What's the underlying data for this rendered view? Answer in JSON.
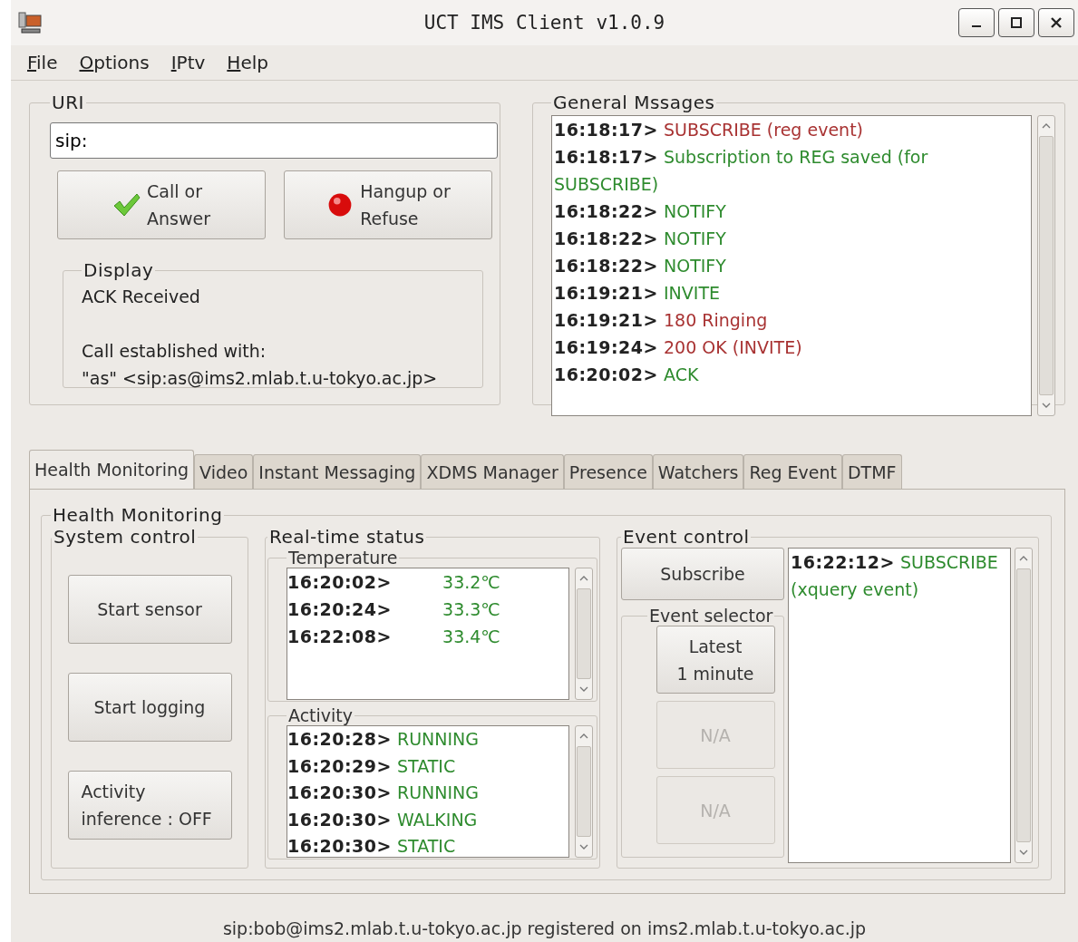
{
  "window": {
    "title": "UCT IMS Client v1.0.9"
  },
  "menu": [
    "File",
    "Options",
    "IPtv",
    "Help"
  ],
  "uri": {
    "label": "URI",
    "value": "sip:"
  },
  "call_buttons": [
    {
      "kind": "call",
      "label": "Call or\nAnswer"
    },
    {
      "kind": "hangup",
      "label": "Hangup or\nRefuse"
    }
  ],
  "display": {
    "label": "Display",
    "paragraphs": [
      [
        "ACK Received"
      ],
      [
        "Call established with:",
        "\"as\" <sip:as@ims2.mlab.t.u-tokyo.ac.jp>"
      ]
    ]
  },
  "general_messages": {
    "label": "General Mssages",
    "items": [
      {
        "time": "16:18:17>",
        "text": "SUBSCRIBE (reg event)",
        "color": "#a83232"
      },
      {
        "time": "16:18:17>",
        "text": "Subscription to REG saved (for SUBSCRIBE)",
        "color": "#2e8b2e"
      },
      {
        "time": "16:18:22>",
        "text": "NOTIFY",
        "color": "#2e8b2e"
      },
      {
        "time": "16:18:22>",
        "text": "NOTIFY",
        "color": "#2e8b2e"
      },
      {
        "time": "16:18:22>",
        "text": "NOTIFY",
        "color": "#2e8b2e"
      },
      {
        "time": "16:19:21>",
        "text": "INVITE",
        "color": "#2e8b2e"
      },
      {
        "time": "16:19:21>",
        "text": "180 Ringing",
        "color": "#a83232"
      },
      {
        "time": "16:19:24>",
        "text": "200 OK (INVITE)",
        "color": "#a83232"
      },
      {
        "time": "16:20:02>",
        "text": "ACK",
        "color": "#2e8b2e"
      }
    ]
  },
  "tabs": [
    {
      "label": "Health Monitoring",
      "selected": true
    },
    {
      "label": "Video",
      "selected": false
    },
    {
      "label": "Instant Messaging",
      "selected": false
    },
    {
      "label": "XDMS Manager",
      "selected": false
    },
    {
      "label": "Presence",
      "selected": false
    },
    {
      "label": "Watchers",
      "selected": false
    },
    {
      "label": "Reg Event",
      "selected": false
    },
    {
      "label": "DTMF",
      "selected": false
    }
  ],
  "health": {
    "label": "Health Monitoring",
    "system_control": {
      "label": "System control",
      "buttons": [
        "Start sensor",
        "Start logging",
        "Activity\ninference : OFF"
      ]
    },
    "realtime": {
      "label": "Real-time status",
      "temperature": {
        "label": "Temperature",
        "items": [
          {
            "time": "16:20:02>",
            "value": "33.2℃"
          },
          {
            "time": "16:20:24>",
            "value": "33.3℃"
          },
          {
            "time": "16:22:08>",
            "value": "33.4℃"
          }
        ]
      },
      "activity": {
        "label": "Activity",
        "items": [
          {
            "time": "16:20:28>",
            "value": "RUNNING"
          },
          {
            "time": "16:20:29>",
            "value": "STATIC"
          },
          {
            "time": "16:20:30>",
            "value": "RUNNING"
          },
          {
            "time": "16:20:30>",
            "value": "WALKING"
          },
          {
            "time": "16:20:30>",
            "value": "STATIC"
          }
        ]
      }
    },
    "event_control": {
      "label": "Event control",
      "subscribe": "Subscribe",
      "selector_label": "Event selector",
      "selector_buttons": [
        {
          "label": "Latest\n1 minute",
          "disabled": false
        },
        {
          "label": "N/A",
          "disabled": true
        },
        {
          "label": "N/A",
          "disabled": true
        }
      ],
      "log": [
        {
          "time": "16:22:12>",
          "text": "SUBSCRIBE (xquery event)"
        }
      ]
    }
  },
  "status_bar": "sip:bob@ims2.mlab.t.u-tokyo.ac.jp registered on ims2.mlab.t.u-tokyo.ac.jp"
}
